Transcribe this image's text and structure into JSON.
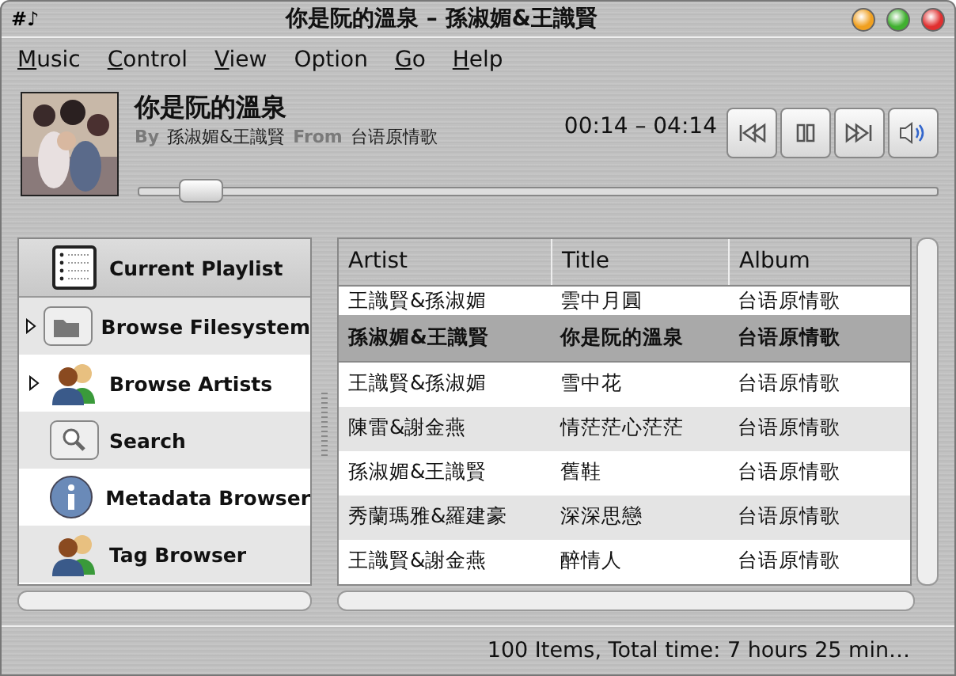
{
  "window": {
    "title": "你是阮的溫泉 – 孫淑媚&王識賢",
    "app_glyph": "#♪"
  },
  "menu": [
    {
      "label": "Music",
      "underline_first": true
    },
    {
      "label": "Control",
      "underline_first": true
    },
    {
      "label": "View",
      "underline_first": true
    },
    {
      "label": "Option",
      "underline_first": false
    },
    {
      "label": "Go",
      "underline_first": true
    },
    {
      "label": "Help",
      "underline_first": true
    }
  ],
  "now_playing": {
    "title": "你是阮的溫泉",
    "by_label": "By",
    "artist": "孫淑媚&王識賢",
    "from_label": "From",
    "album": "台语原情歌",
    "time": "00:14 – 04:14",
    "level": 0.06
  },
  "sidebar": {
    "items": [
      {
        "label": "Current Playlist",
        "kind": "playlist",
        "selected": true,
        "expandable": false
      },
      {
        "label": "Browse Filesystem",
        "kind": "folder",
        "selected": false,
        "expandable": true
      },
      {
        "label": "Browse Artists",
        "kind": "people",
        "selected": false,
        "expandable": true
      },
      {
        "label": "Search",
        "kind": "search",
        "selected": false,
        "expandable": false
      },
      {
        "label": "Metadata Browser",
        "kind": "info",
        "selected": false,
        "expandable": false
      },
      {
        "label": "Tag Browser",
        "kind": "people",
        "selected": false,
        "expandable": false
      }
    ]
  },
  "table": {
    "columns": [
      "Artist",
      "Title",
      "Album"
    ],
    "rows": [
      {
        "cells": [
          "王識賢&孫淑媚",
          "雲中月圓",
          "台语原情歌"
        ],
        "selected": false,
        "partial": true
      },
      {
        "cells": [
          "孫淑媚&王識賢",
          "你是阮的溫泉",
          "台语原情歌"
        ],
        "selected": true,
        "partial": false
      },
      {
        "cells": [
          "王識賢&孫淑媚",
          "雪中花",
          "台语原情歌"
        ],
        "selected": false,
        "partial": false
      },
      {
        "cells": [
          "陳雷&謝金燕",
          "情茫茫心茫茫",
          "台语原情歌"
        ],
        "selected": false,
        "partial": false
      },
      {
        "cells": [
          "孫淑媚&王識賢",
          "舊鞋",
          "台语原情歌"
        ],
        "selected": false,
        "partial": false
      },
      {
        "cells": [
          "秀蘭瑪雅&羅建豪",
          "深深思戀",
          "台语原情歌"
        ],
        "selected": false,
        "partial": false
      },
      {
        "cells": [
          "王識賢&謝金燕",
          "醉情人",
          "台语原情歌"
        ],
        "selected": false,
        "partial": false
      }
    ]
  },
  "status_bar": "100 Items,  Total time: 7 hours 25 min…"
}
